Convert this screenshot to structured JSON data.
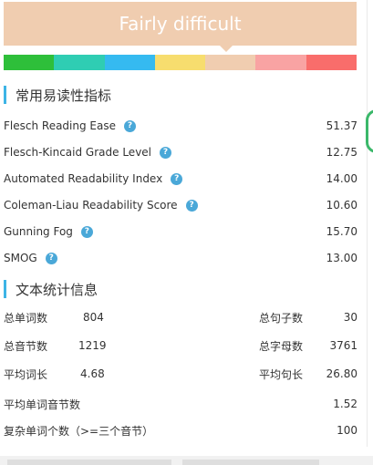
{
  "difficulty_label": "Fairly difficult",
  "scale_colors": [
    "#2ebf3a",
    "#2fcdb3",
    "#35baf0",
    "#f7dd6e",
    "#f0cdb0",
    "#f9a3a3",
    "#f96d6b"
  ],
  "readability": {
    "section_title": "常用易读性指标",
    "metrics": [
      {
        "label": "Flesch Reading Ease",
        "value": "51.37"
      },
      {
        "label": "Flesch-Kincaid Grade Level",
        "value": "12.75"
      },
      {
        "label": "Automated Readability Index",
        "value": "14.00"
      },
      {
        "label": "Coleman-Liau Readability Score",
        "value": "10.60"
      },
      {
        "label": "Gunning Fog",
        "value": "15.70"
      },
      {
        "label": "SMOG",
        "value": "13.00"
      }
    ]
  },
  "stats": {
    "section_title": "文本统计信息",
    "pairs": [
      {
        "left_label": "总单词数",
        "left_value": "804",
        "right_label": "总句子数",
        "right_value": "30"
      },
      {
        "left_label": "总音节数",
        "left_value": "1219",
        "right_label": "总字母数",
        "right_value": "3761"
      },
      {
        "left_label": "平均词长",
        "left_value": "4.68",
        "right_label": "平均句长",
        "right_value": "26.80"
      }
    ],
    "singles": [
      {
        "label": "平均单词音节数",
        "value": "1.52"
      },
      {
        "label": "复杂单词个数（>=三个音节）",
        "value": "100"
      }
    ]
  },
  "help_icon": "question-circle-icon"
}
